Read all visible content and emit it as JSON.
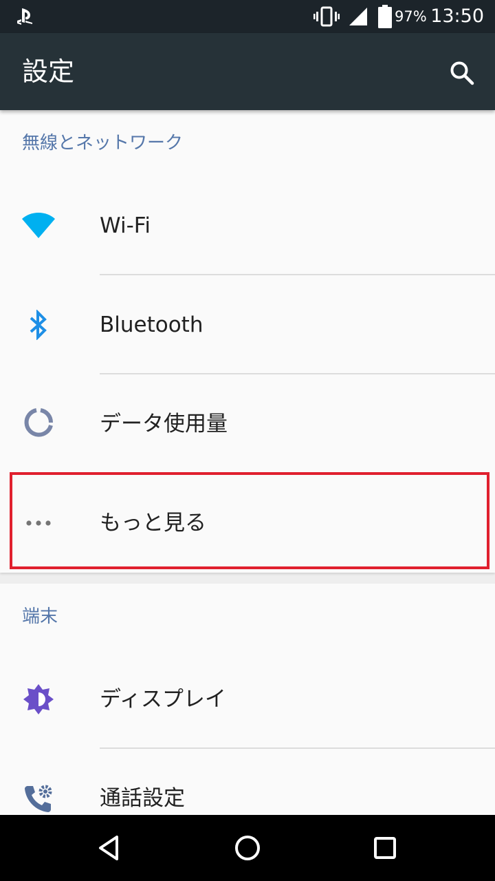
{
  "status_bar": {
    "notification_icon": "playstation-icon",
    "vibrate_icon": "vibrate-icon",
    "signal_icon": "cell-signal-icon",
    "battery_icon": "battery-icon",
    "battery_percent": "97%",
    "battery_level": 0.97,
    "time": "13:50"
  },
  "app_bar": {
    "title": "設定",
    "search_icon": "search-icon",
    "color": "#263238"
  },
  "sections": [
    {
      "header": "無線とネットワーク",
      "items": [
        {
          "label": "Wi-Fi",
          "icon": "wifi-icon",
          "icon_color": "#00b0f0"
        },
        {
          "label": "Bluetooth",
          "icon": "bluetooth-icon",
          "icon_color": "#1e8fe6"
        },
        {
          "label": "データ使用量",
          "icon": "data-usage-icon",
          "icon_color": "#7986a8"
        },
        {
          "label": "もっと見る",
          "icon": "more-horizontal-icon",
          "icon_color": "#757575",
          "highlighted": true
        }
      ]
    },
    {
      "header": "端末",
      "items": [
        {
          "label": "ディスプレイ",
          "icon": "brightness-icon",
          "icon_color": "#6a4fc8"
        },
        {
          "label": "通話設定",
          "icon": "call-settings-icon",
          "icon_color": "#546e9a"
        }
      ]
    }
  ],
  "nav_bar": {
    "back_icon": "back-icon",
    "home_icon": "home-icon",
    "recents_icon": "recents-icon"
  },
  "colors": {
    "header_text": "#5577aa",
    "highlight_border": "#e0202e"
  }
}
